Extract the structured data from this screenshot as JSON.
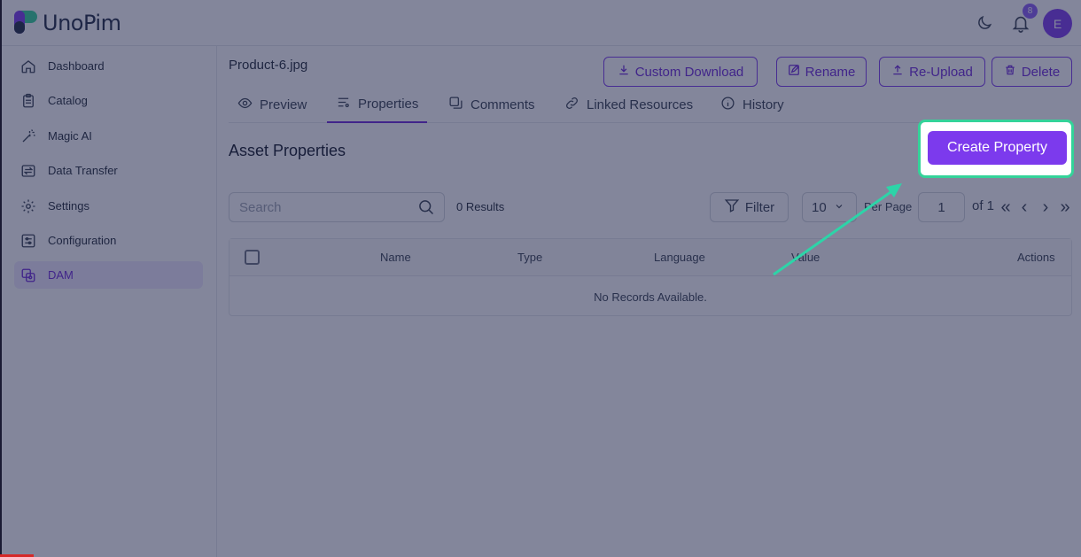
{
  "app": {
    "name": "UnoPim"
  },
  "header": {
    "notification_count": "8",
    "avatar_initial": "E"
  },
  "sidebar": {
    "items": [
      {
        "label": "Dashboard",
        "icon": "home-icon"
      },
      {
        "label": "Catalog",
        "icon": "clipboard-icon"
      },
      {
        "label": "Magic AI",
        "icon": "magic-wand-icon"
      },
      {
        "label": "Data Transfer",
        "icon": "data-transfer-icon"
      },
      {
        "label": "Settings",
        "icon": "gear-icon"
      },
      {
        "label": "Configuration",
        "icon": "sliders-icon"
      },
      {
        "label": "DAM",
        "icon": "dam-icon",
        "active": true
      }
    ]
  },
  "asset": {
    "file_name": "Product-6.jpg"
  },
  "actions": {
    "custom_download": "Custom Download",
    "rename": "Rename",
    "reupload": "Re-Upload",
    "delete": "Delete"
  },
  "tabs": [
    {
      "label": "Preview",
      "icon": "eye-icon"
    },
    {
      "label": "Properties",
      "icon": "properties-icon",
      "active": true
    },
    {
      "label": "Comments",
      "icon": "comments-icon"
    },
    {
      "label": "Linked Resources",
      "icon": "link-icon"
    },
    {
      "label": "History",
      "icon": "info-icon"
    }
  ],
  "properties": {
    "title": "Asset Properties",
    "create_button": "Create Property",
    "search_placeholder": "Search",
    "results": "0 Results",
    "filter": "Filter",
    "per_page_value": "10",
    "per_page_label": "Per Page",
    "current_page": "1",
    "of_pages": "of 1"
  },
  "table": {
    "columns": [
      "Name",
      "Type",
      "Language",
      "Value",
      "Actions"
    ],
    "empty_text": "No Records Available."
  },
  "colors": {
    "accent": "#7c3aed",
    "highlight": "#34d399",
    "overlay": "#1e2248"
  }
}
